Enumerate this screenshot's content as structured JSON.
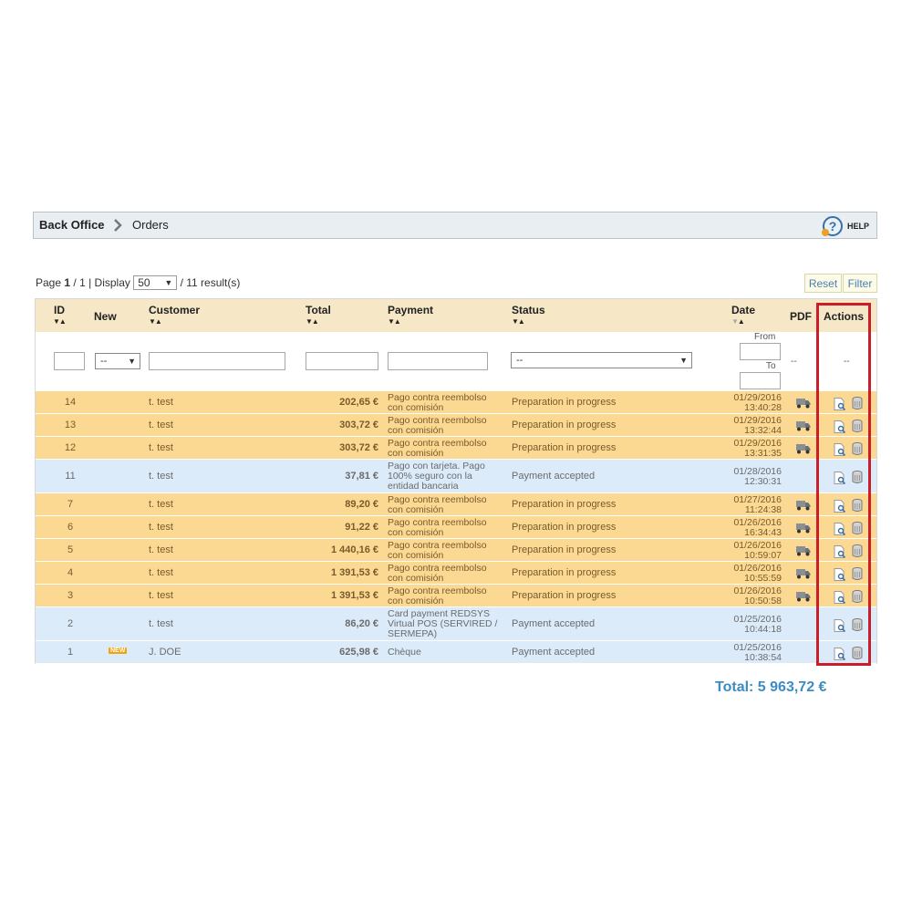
{
  "breadcrumb": {
    "root": "Back Office",
    "current": "Orders",
    "help": "HELP"
  },
  "pager": {
    "page_label": "Page",
    "page": "1",
    "of": "/ 1 | Display",
    "display_value": "50",
    "results": "/ 11 result(s)"
  },
  "buttons": {
    "reset": "Reset",
    "filter": "Filter"
  },
  "headers": {
    "id": "ID",
    "new": "New",
    "customer": "Customer",
    "total": "Total",
    "payment": "Payment",
    "status": "Status",
    "date": "Date",
    "pdf": "PDF",
    "actions": "Actions"
  },
  "filters": {
    "new_value": "--",
    "status_value": "--",
    "date_from": "From",
    "date_to": "To",
    "pdf_value": "--",
    "actions_value": "--"
  },
  "rows": [
    {
      "id": "14",
      "new": "",
      "customer": "t. test",
      "total": "202,65 €",
      "payment": "Pago contra reembolso con comisión",
      "status": "Preparation in progress",
      "date": "01/29/2016",
      "time": "13:40:28",
      "pdf": true,
      "color": "orange"
    },
    {
      "id": "13",
      "new": "",
      "customer": "t. test",
      "total": "303,72 €",
      "payment": "Pago contra reembolso con comisión",
      "status": "Preparation in progress",
      "date": "01/29/2016",
      "time": "13:32:44",
      "pdf": true,
      "color": "orange"
    },
    {
      "id": "12",
      "new": "",
      "customer": "t. test",
      "total": "303,72 €",
      "payment": "Pago contra reembolso con comisión",
      "status": "Preparation in progress",
      "date": "01/29/2016",
      "time": "13:31:35",
      "pdf": true,
      "color": "orange"
    },
    {
      "id": "11",
      "new": "",
      "customer": "t. test",
      "total": "37,81 €",
      "payment": "Pago con tarjeta. Pago 100% seguro con la entidad bancaria",
      "status": "Payment accepted",
      "date": "01/28/2016",
      "time": "12:30:31",
      "pdf": false,
      "color": "blue"
    },
    {
      "id": "7",
      "new": "",
      "customer": "t. test",
      "total": "89,20 €",
      "payment": "Pago contra reembolso con comisión",
      "status": "Preparation in progress",
      "date": "01/27/2016",
      "time": "11:24:38",
      "pdf": true,
      "color": "orange"
    },
    {
      "id": "6",
      "new": "",
      "customer": "t. test",
      "total": "91,22 €",
      "payment": "Pago contra reembolso con comisión",
      "status": "Preparation in progress",
      "date": "01/26/2016",
      "time": "16:34:43",
      "pdf": true,
      "color": "orange"
    },
    {
      "id": "5",
      "new": "",
      "customer": "t. test",
      "total": "1 440,16 €",
      "payment": "Pago contra reembolso con comisión",
      "status": "Preparation in progress",
      "date": "01/26/2016",
      "time": "10:59:07",
      "pdf": true,
      "color": "orange"
    },
    {
      "id": "4",
      "new": "",
      "customer": "t. test",
      "total": "1 391,53 €",
      "payment": "Pago contra reembolso con comisión",
      "status": "Preparation in progress",
      "date": "01/26/2016",
      "time": "10:55:59",
      "pdf": true,
      "color": "orange"
    },
    {
      "id": "3",
      "new": "",
      "customer": "t. test",
      "total": "1 391,53 €",
      "payment": "Pago contra reembolso con comisión",
      "status": "Preparation in progress",
      "date": "01/26/2016",
      "time": "10:50:58",
      "pdf": true,
      "color": "orange"
    },
    {
      "id": "2",
      "new": "",
      "customer": "t. test",
      "total": "86,20 €",
      "payment": "Card payment REDSYS Virtual POS (SERVIRED / SERMEPA)",
      "status": "Payment accepted",
      "date": "01/25/2016",
      "time": "10:44:18",
      "pdf": false,
      "color": "blue"
    },
    {
      "id": "1",
      "new": "NEW",
      "customer": "J. DOE",
      "total": "625,98 €",
      "payment": "Chèque",
      "status": "Payment accepted",
      "date": "01/25/2016",
      "time": "10:38:54",
      "pdf": false,
      "color": "blue"
    }
  ],
  "total_label": "Total: 5 963,72 €",
  "colors": {
    "orange_row": "#fbd993",
    "blue_row": "#dbebfa",
    "header": "#f6e8c6",
    "highlight": "#cc1e2a",
    "total": "#3d8cc3"
  }
}
